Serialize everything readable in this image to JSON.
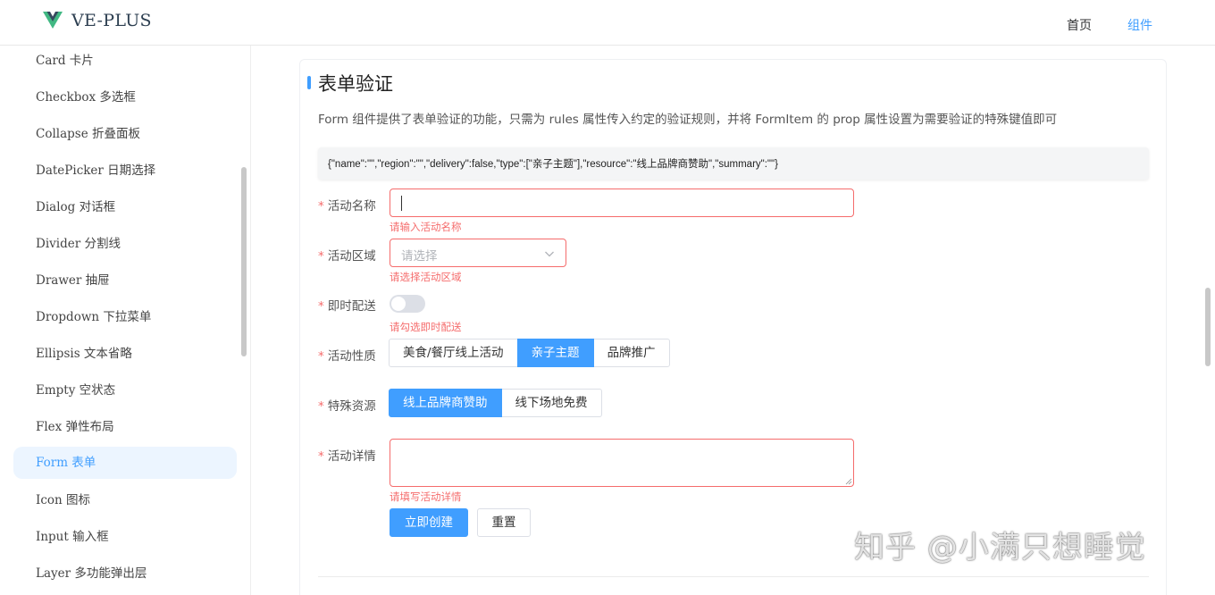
{
  "header": {
    "logo_text": "VE-PLUS",
    "nav": [
      {
        "label": "首页"
      },
      {
        "label": "组件"
      }
    ]
  },
  "sidebar": {
    "items": [
      {
        "label": "Card 卡片"
      },
      {
        "label": "Checkbox 多选框"
      },
      {
        "label": "Collapse 折叠面板"
      },
      {
        "label": "DatePicker 日期选择"
      },
      {
        "label": "Dialog 对话框"
      },
      {
        "label": "Divider 分割线"
      },
      {
        "label": "Drawer 抽屉"
      },
      {
        "label": "Dropdown 下拉菜单"
      },
      {
        "label": "Ellipsis 文本省略"
      },
      {
        "label": "Empty 空状态"
      },
      {
        "label": "Flex 弹性布局"
      },
      {
        "label": "Form 表单"
      },
      {
        "label": "Icon 图标"
      },
      {
        "label": "Input 输入框"
      },
      {
        "label": "Layer 多功能弹出层"
      }
    ],
    "active_label": "Form 表单"
  },
  "main": {
    "title": "表单验证",
    "description": "Form 组件提供了表单验证的功能，只需为 rules 属性传入约定的验证规则，并将 FormItem 的 prop 属性设置为需要验证的特殊键值即可",
    "model_json": "{\"name\":\"\",\"region\":\"\",\"delivery\":false,\"type\":[\"亲子主题\"],\"resource\":\"线上品牌商赞助\",\"summary\":\"\"}"
  },
  "form": {
    "required_mark": "*",
    "name": {
      "label": "活动名称",
      "value": "",
      "error": "请输入活动名称"
    },
    "region": {
      "label": "活动区域",
      "placeholder": "请选择",
      "error": "请选择活动区域"
    },
    "delivery": {
      "label": "即时配送",
      "checked": false,
      "error": "请勾选即时配送"
    },
    "type": {
      "label": "活动性质",
      "options": [
        {
          "label": "美食/餐厅线上活动",
          "selected": false
        },
        {
          "label": "亲子主题",
          "selected": true
        },
        {
          "label": "品牌推广",
          "selected": false
        }
      ]
    },
    "resource": {
      "label": "特殊资源",
      "options": [
        {
          "label": "线上品牌商赞助",
          "selected": true
        },
        {
          "label": "线下场地免费",
          "selected": false
        }
      ]
    },
    "summary": {
      "label": "活动详情",
      "value": "",
      "error": "请填写活动详情"
    },
    "submit_label": "立即创建",
    "reset_label": "重置"
  },
  "colors": {
    "primary": "#409eff",
    "error": "#f56c6c",
    "active_bg": "#ecf5ff"
  },
  "watermark": "知乎 @小满只想睡觉"
}
